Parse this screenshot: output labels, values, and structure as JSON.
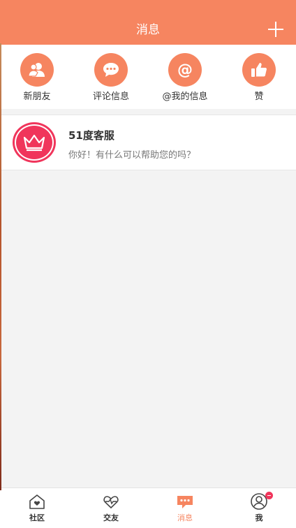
{
  "header": {
    "title": "消息",
    "plus_icon": "plus-icon"
  },
  "shortcuts": [
    {
      "label": "新朋友",
      "icon": "users-icon"
    },
    {
      "label": "评论信息",
      "icon": "chat-bubble-icon"
    },
    {
      "label": "@我的信息",
      "icon": "at-icon"
    },
    {
      "label": "赞",
      "icon": "thumbs-up-icon"
    }
  ],
  "messages": [
    {
      "name": "51度客服",
      "preview": "你好！有什么可以帮助您的吗？",
      "avatar_icon": "crown-icon"
    }
  ],
  "tabbar": {
    "tabs": [
      {
        "label": "社区",
        "icon": "home-heart-icon"
      },
      {
        "label": "交友",
        "icon": "heart-pulse-icon"
      },
      {
        "label": "消息",
        "icon": "message-icon",
        "active": true
      },
      {
        "label": "我",
        "icon": "profile-icon",
        "badge": true
      }
    ]
  },
  "colors": {
    "accent": "#f68560",
    "badge": "#f0355b",
    "background": "#f3f3f3"
  }
}
